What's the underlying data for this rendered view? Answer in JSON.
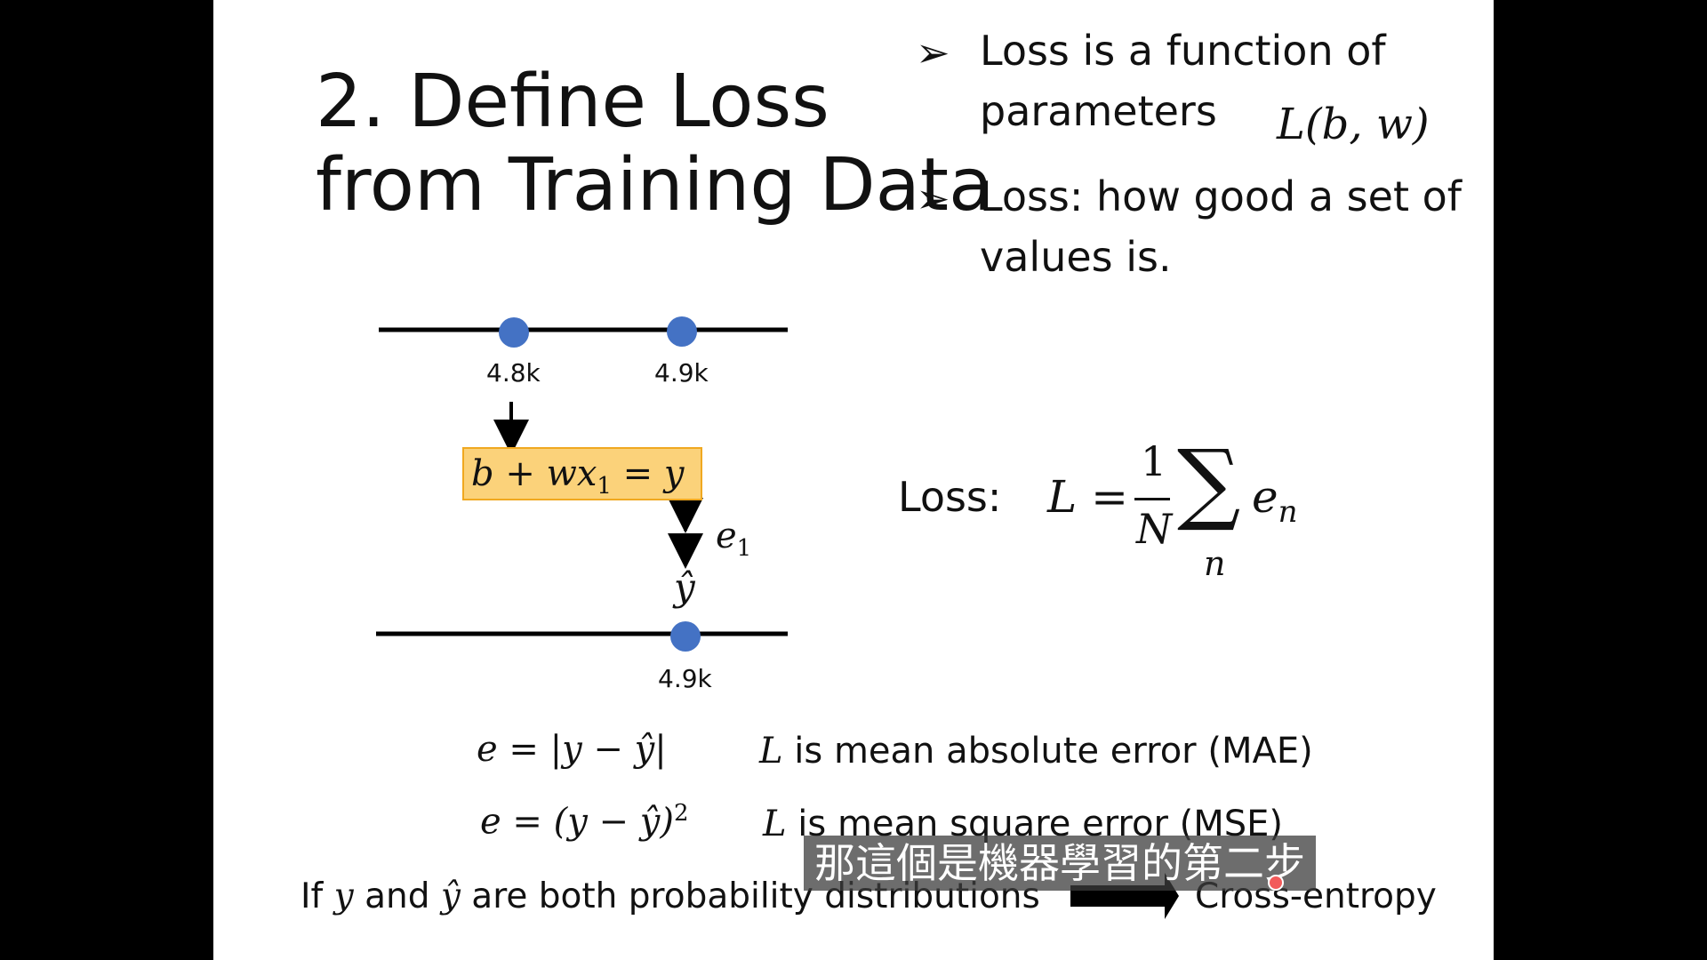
{
  "slide": {
    "title_line1": "2. Define Loss",
    "title_line2": "from Training Data",
    "bullets": [
      {
        "marker": "➢",
        "line1": "Loss is a function of",
        "line2": "parameters"
      },
      {
        "marker": "➢",
        "line1": "Loss: how good a set of",
        "line2": "values is."
      }
    ],
    "params_formula": "L(b, w)",
    "diagram": {
      "top_labels": [
        "4.8k",
        "4.9k"
      ],
      "bottom_label": "4.9k",
      "model_formula": {
        "b": "b",
        "plus": " + ",
        "w": "w",
        "x": "x",
        "sub": "1",
        "eq": " = y"
      },
      "error_label": {
        "base": "e",
        "sub": "1"
      },
      "yhat": "ŷ"
    },
    "loss": {
      "label": "Loss:",
      "L_eq": "L =",
      "num": "1",
      "den": "N",
      "sigma": "∑",
      "sum_index": "n",
      "term_base": "e",
      "term_sub": "n"
    },
    "mae": {
      "formula": "e = |y − ŷ|",
      "L": "L",
      "desc": " is mean absolute error (MAE)"
    },
    "mse": {
      "formula_base": "e = (y − ŷ)",
      "exp": "2",
      "L": "L",
      "desc": " is mean square error (MSE)"
    },
    "footer": {
      "p1": "If ",
      "y": "y",
      "p2": " and ",
      "yhat": "ŷ",
      "p3": " are both probability distributions",
      "result": "Cross-entropy"
    }
  },
  "subtitle": "那這個是機器學習的第二步",
  "colors": {
    "dot": "#4472c4",
    "box_fill": "#fbd27a",
    "box_border": "#f0a820",
    "arrow": "#000000"
  }
}
